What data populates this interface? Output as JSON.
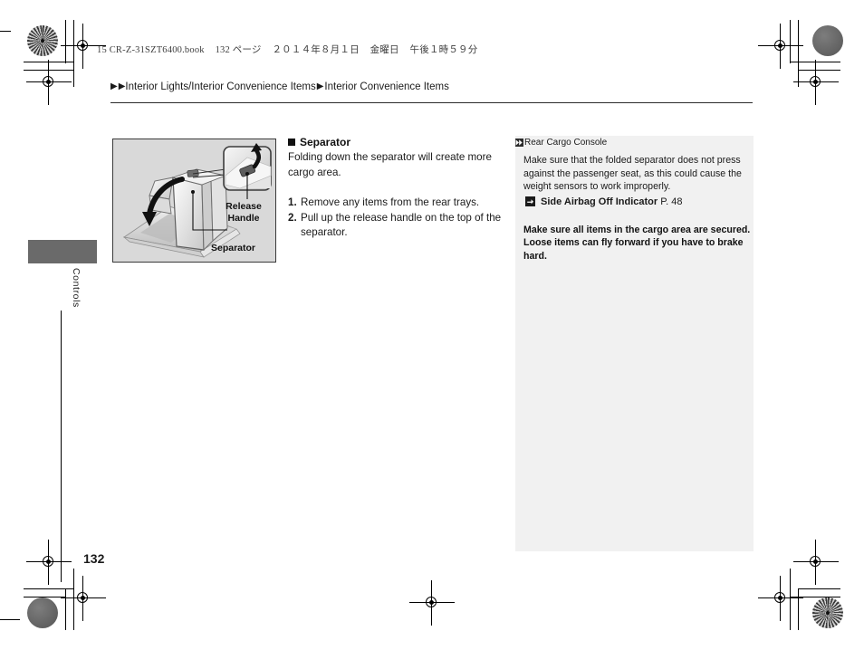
{
  "print_header": {
    "file": "15 CR-Z-31SZT6400.book",
    "page_label": "132 ページ",
    "date": "２０１４年８月１日",
    "weekday": "金曜日",
    "time": "午後１時５９分"
  },
  "breadcrumb": {
    "arrow_glyph": "▶",
    "item1": "Interior Lights/Interior Convenience Items",
    "item2": "Interior Convenience Items"
  },
  "side_tab": {
    "label": "Controls",
    "block_color": "#6a6a6a"
  },
  "figure": {
    "callout_release": "Release\nHandle",
    "callout_release_line1": "Release",
    "callout_release_line2": "Handle",
    "callout_separator": "Separator",
    "alt": "Rear cargo separator folding illustration with release handle inset"
  },
  "main": {
    "section_title": "Separator",
    "intro": "Folding down the separator will create more cargo area.",
    "steps": [
      {
        "num": "1.",
        "text": "Remove any items from the rear trays."
      },
      {
        "num": "2.",
        "text": "Pull up the release handle on the top of the separator."
      }
    ]
  },
  "side_panel": {
    "heading": "Rear Cargo Console",
    "note": "Make sure that the folded separator does not press against the passenger seat, as this could cause the weight sensors to work improperly.",
    "reference": {
      "title": "Side Airbag Off Indicator",
      "page": "P. 48"
    },
    "warning": "Make sure all items in the cargo area are secured. Loose items can fly forward if you have to brake hard.",
    "background_color": "#f1f1f1"
  },
  "page_number": "132"
}
